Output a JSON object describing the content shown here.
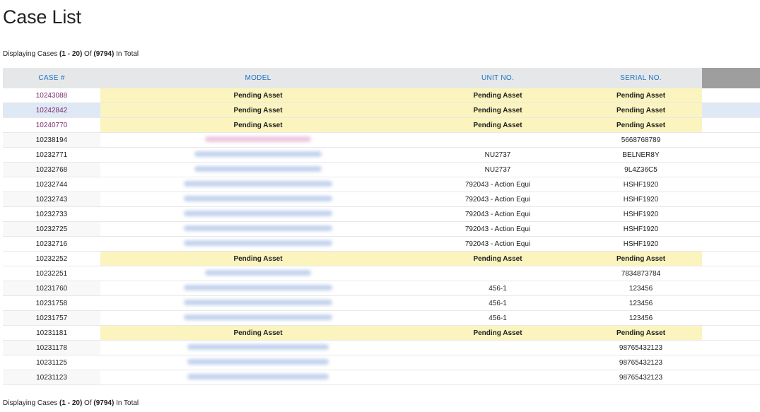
{
  "page": {
    "title": "Case List",
    "display_top": {
      "prefix": "Displaying Cases ",
      "range": "(1 - 20)",
      "of": " Of ",
      "total": "(9794)",
      "suffix": " In Total"
    },
    "display_bottom": {
      "prefix": "Displaying Cases ",
      "range": "(1 - 20)",
      "of": " Of ",
      "total": "(9794)",
      "suffix": " In Total"
    }
  },
  "table": {
    "headers": {
      "case": "CASE #",
      "model": "MODEL",
      "unit": "UNIT NO.",
      "serial": "SERIAL NO."
    },
    "colors": {
      "link": "#1a73c7",
      "visited": "#7b2a6d",
      "pending_bg": "#fbf4bf",
      "selected_bg": "#dfe9f6"
    },
    "rows": [
      {
        "case": "10243088",
        "model": "Pending Asset",
        "unit": "Pending Asset",
        "serial": "Pending Asset"
      },
      {
        "case": "10242842",
        "model": "Pending Asset",
        "unit": "Pending Asset",
        "serial": "Pending Asset"
      },
      {
        "case": "10240770",
        "model": "Pending Asset",
        "unit": "Pending Asset",
        "serial": "Pending Asset"
      },
      {
        "case": "10238194",
        "model": "",
        "unit": "",
        "serial": "5668768789"
      },
      {
        "case": "10232771",
        "model": "",
        "unit": "NU2737",
        "serial": "BELNER8Y"
      },
      {
        "case": "10232768",
        "model": "",
        "unit": "NU2737",
        "serial": "9L4Z36C5"
      },
      {
        "case": "10232744",
        "model": "",
        "unit": "792043 - Action Equi",
        "serial": "HSHF1920"
      },
      {
        "case": "10232743",
        "model": "",
        "unit": "792043 - Action Equi",
        "serial": "HSHF1920"
      },
      {
        "case": "10232733",
        "model": "",
        "unit": "792043 - Action Equi",
        "serial": "HSHF1920"
      },
      {
        "case": "10232725",
        "model": "",
        "unit": "792043 - Action Equi",
        "serial": "HSHF1920"
      },
      {
        "case": "10232716",
        "model": "",
        "unit": "792043 - Action Equi",
        "serial": "HSHF1920"
      },
      {
        "case": "10232252",
        "model": "Pending Asset",
        "unit": "Pending Asset",
        "serial": "Pending Asset"
      },
      {
        "case": "10232251",
        "model": "",
        "unit": "",
        "serial": "7834873784"
      },
      {
        "case": "10231760",
        "model": "",
        "unit": "456-1",
        "serial": "123456"
      },
      {
        "case": "10231758",
        "model": "",
        "unit": "456-1",
        "serial": "123456"
      },
      {
        "case": "10231757",
        "model": "",
        "unit": "456-1",
        "serial": "123456"
      },
      {
        "case": "10231181",
        "model": "Pending Asset",
        "unit": "Pending Asset",
        "serial": "Pending Asset"
      },
      {
        "case": "10231178",
        "model": "",
        "unit": "",
        "serial": "98765432123"
      },
      {
        "case": "10231125",
        "model": "",
        "unit": "",
        "serial": "98765432123"
      },
      {
        "case": "10231123",
        "model": "",
        "unit": "",
        "serial": "98765432123"
      }
    ]
  }
}
